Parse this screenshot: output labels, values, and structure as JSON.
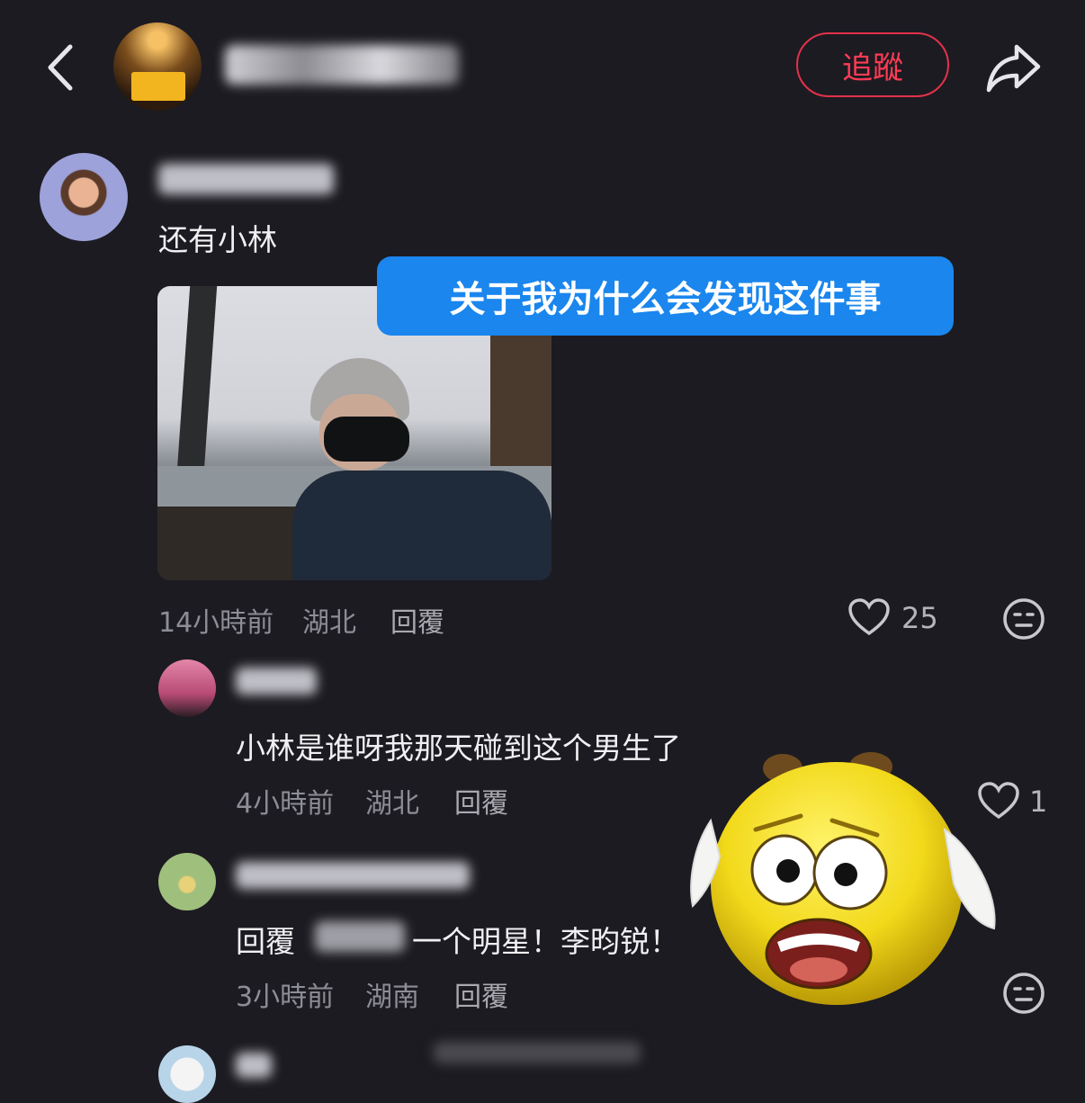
{
  "header": {
    "follow_label": "追蹤",
    "share_icon": "share-arrow-icon",
    "back_icon": "chevron-left-icon"
  },
  "comment1": {
    "text": "还有小林",
    "time": "14小時前",
    "location": "湖北",
    "reply_label": "回覆",
    "likes": "25"
  },
  "overlay_caption": "关于我为什么会发现这件事",
  "comment2": {
    "text": "小林是谁呀我那天碰到这个男生了",
    "time": "4小時前",
    "location": "湖北",
    "reply_label": "回覆",
    "likes": "1"
  },
  "comment3": {
    "reply_prefix": "回覆",
    "text": "一个明星！李昀锐！",
    "time": "3小時前",
    "location": "湖南",
    "reply_label": "回覆"
  },
  "colors": {
    "background": "#1c1b21",
    "accent_red": "#ff3b55",
    "bubble_blue": "#1a86ee"
  }
}
